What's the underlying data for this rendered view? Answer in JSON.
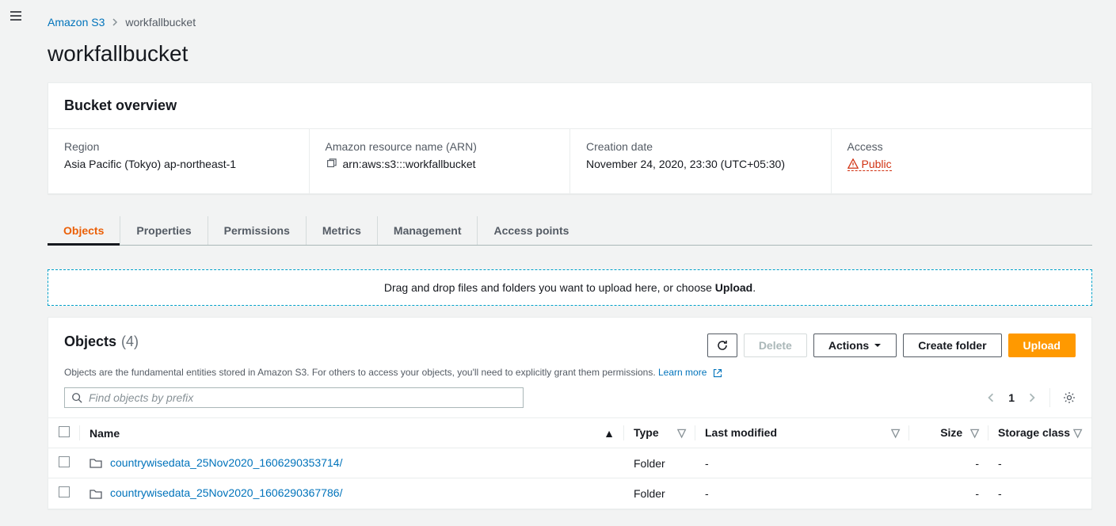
{
  "breadcrumb": {
    "root": "Amazon S3",
    "current": "workfallbucket"
  },
  "page_title": "workfallbucket",
  "overview": {
    "title": "Bucket overview",
    "region_label": "Region",
    "region_value": "Asia Pacific (Tokyo) ap-northeast-1",
    "arn_label": "Amazon resource name (ARN)",
    "arn_value": "arn:aws:s3:::workfallbucket",
    "creation_label": "Creation date",
    "creation_value": "November 24, 2020, 23:30 (UTC+05:30)",
    "access_label": "Access",
    "access_value": "Public"
  },
  "tabs": [
    {
      "label": "Objects",
      "active": true
    },
    {
      "label": "Properties"
    },
    {
      "label": "Permissions"
    },
    {
      "label": "Metrics"
    },
    {
      "label": "Management"
    },
    {
      "label": "Access points"
    }
  ],
  "dropzone": {
    "text": "Drag and drop files and folders you want to upload here, or choose ",
    "bold": "Upload",
    "suffix": "."
  },
  "objects": {
    "title": "Objects",
    "count": "(4)",
    "desc_prefix": "Objects are the fundamental entities stored in Amazon S3. For others to access your objects, you'll need to explicitly grant them permissions. ",
    "learn_more": "Learn more",
    "search_placeholder": "Find objects by prefix",
    "page": "1",
    "buttons": {
      "refresh": "Refresh",
      "delete": "Delete",
      "actions": "Actions",
      "create_folder": "Create folder",
      "upload": "Upload"
    },
    "columns": {
      "name": "Name",
      "type": "Type",
      "last_modified": "Last modified",
      "size": "Size",
      "storage_class": "Storage class"
    },
    "rows": [
      {
        "name": "countrywisedata_25Nov2020_1606290353714/",
        "type": "Folder",
        "last_modified": "-",
        "size": "-",
        "storage_class": "-"
      },
      {
        "name": "countrywisedata_25Nov2020_1606290367786/",
        "type": "Folder",
        "last_modified": "-",
        "size": "-",
        "storage_class": "-"
      }
    ]
  }
}
